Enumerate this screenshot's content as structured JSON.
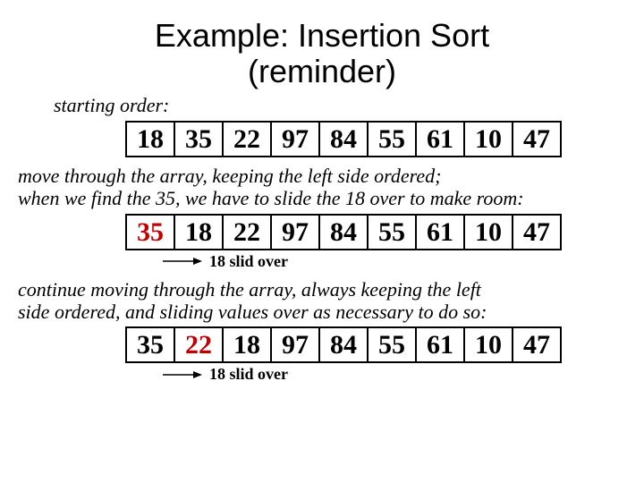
{
  "title_line1": "Example: Insertion Sort",
  "title_line2": "(reminder)",
  "caption1": "starting order:",
  "row1": [
    "18",
    "35",
    "22",
    "97",
    "84",
    "55",
    "61",
    "10",
    "47"
  ],
  "desc1a": "move through the array, keeping the left side ordered;",
  "desc1b": "when we find the 35, we have to slide the 18 over to make room:",
  "row2": [
    "35",
    "18",
    "22",
    "97",
    "84",
    "55",
    "61",
    "10",
    "47"
  ],
  "row2_red_index": 0,
  "note2": "18 slid over",
  "desc2a": "continue moving through the array, always keeping the left",
  "desc2b": "side ordered, and sliding values over as necessary to do so:",
  "row3": [
    "35",
    "22",
    "18",
    "97",
    "84",
    "55",
    "61",
    "10",
    "47"
  ],
  "row3_red_index": 1,
  "note3": "18 slid over"
}
